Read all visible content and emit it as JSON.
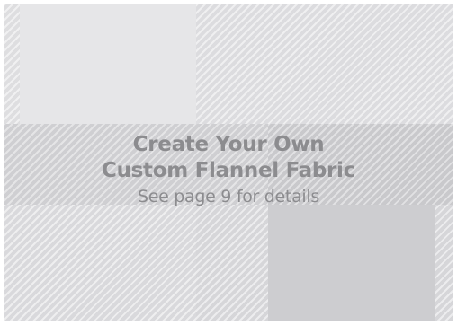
{
  "banner": {
    "title_line1": "Create Your Own",
    "title_line2": "Custom Flannel Fabric",
    "subtitle": "See page 9 for details"
  },
  "colors": {
    "text": "#8c8c8f",
    "fabric_light": "#e6e6e8",
    "fabric_mid": "#dcdcdf",
    "fabric_dark": "#cfcfd2"
  }
}
